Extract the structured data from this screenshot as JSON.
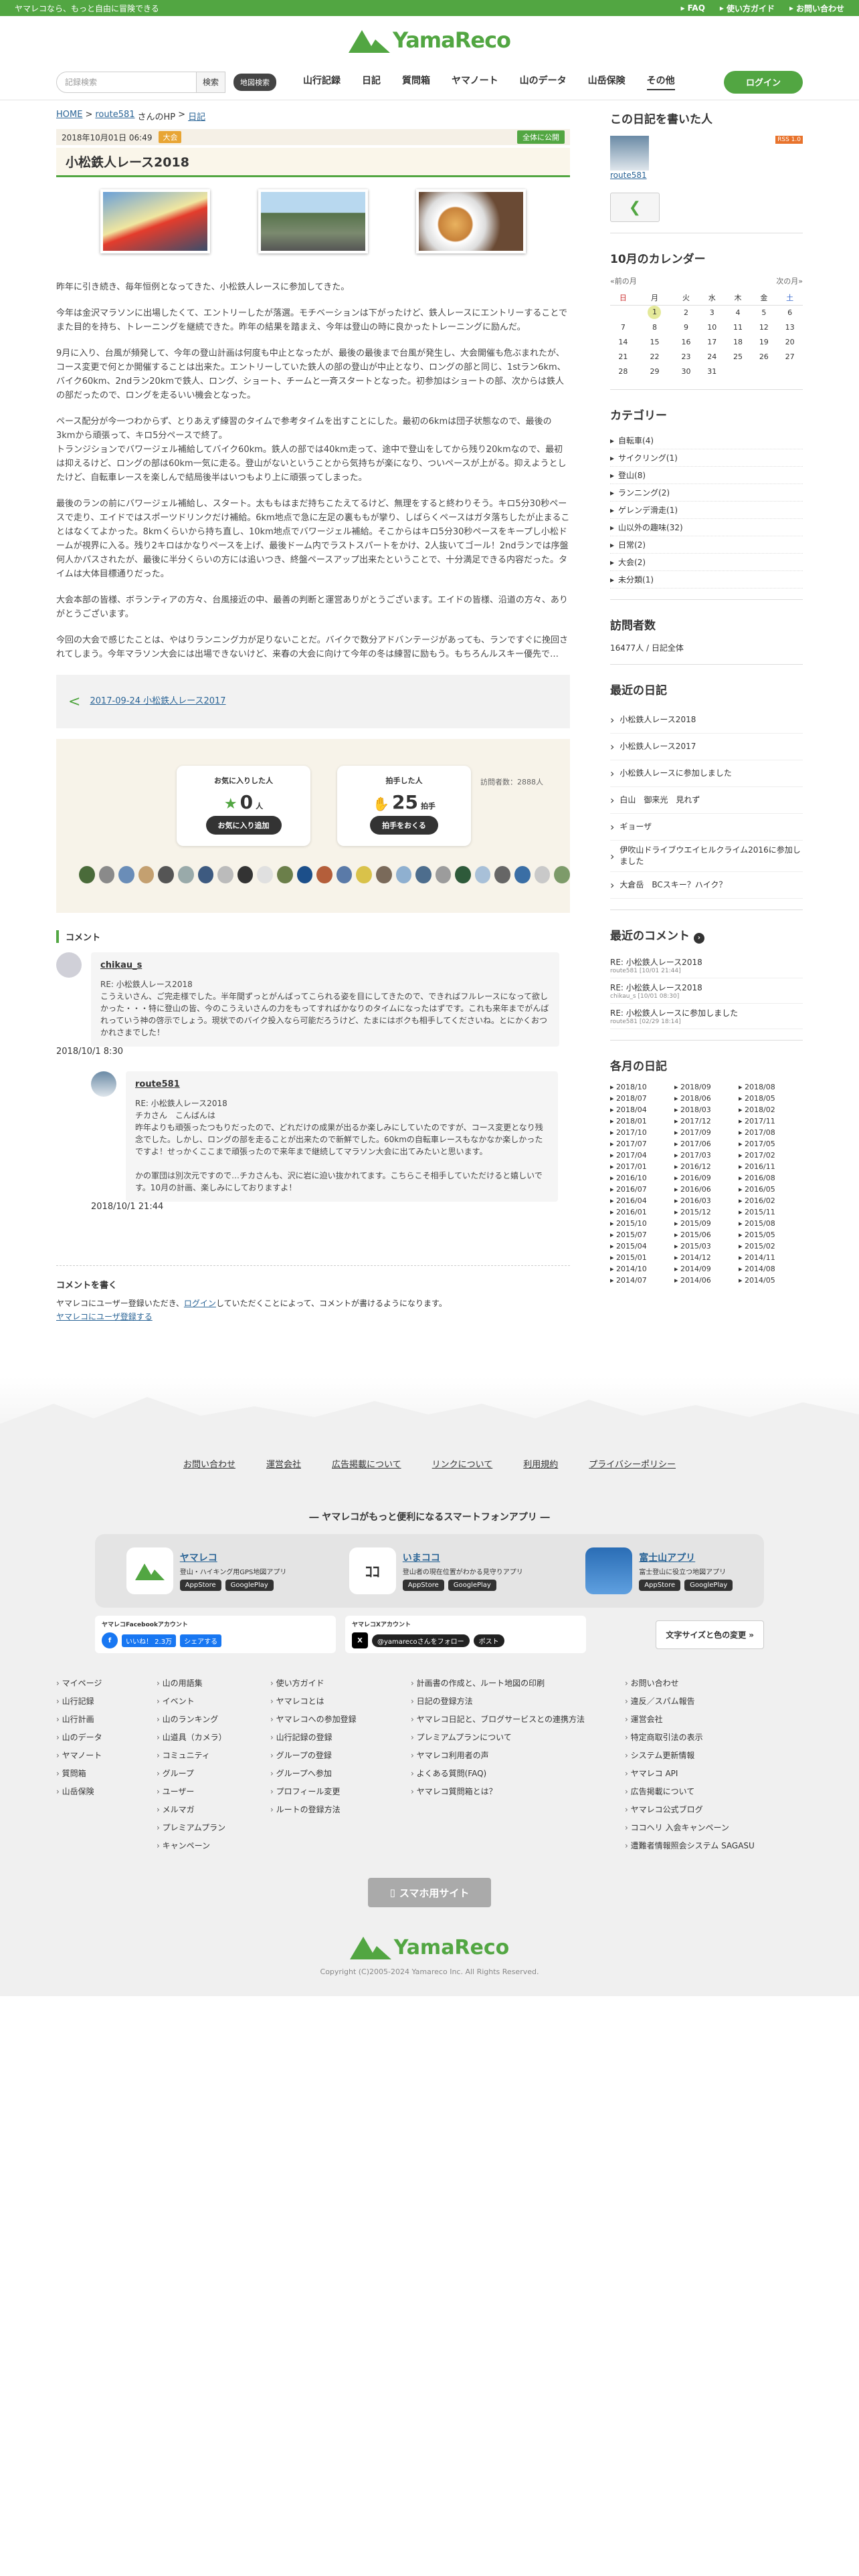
{
  "top": {
    "tagline": "ヤマレコなら、もっと自由に冒険できる",
    "faq": "FAQ",
    "guide": "使い方ガイド",
    "contact": "お問い合わせ"
  },
  "logo": "YamaReco",
  "search": {
    "placeholder": "記録検索",
    "btn": "検索",
    "map": "地図検索"
  },
  "nav": [
    "山行記録",
    "日記",
    "質問箱",
    "ヤマノート",
    "山のデータ",
    "山岳保険",
    "その他"
  ],
  "login": "ログイン",
  "breadcrumb": {
    "home": "HOME",
    "user": "route581",
    "suffix": "さんのHP",
    "sep": ">",
    "diary": "日記"
  },
  "meta": {
    "date": "2018年10月01日 06:49",
    "tag": "大会",
    "public": "全体に公開"
  },
  "title": "小松鉄人レース2018",
  "paragraphs": [
    "昨年に引き続き、毎年恒例となってきた、小松鉄人レースに参加してきた。",
    "今年は金沢マラソンに出場したくて、エントリーしたが落選。モチベーションは下がったけど、鉄人レースにエントリーすることで また目的を持ち、トレーニングを継続できた。昨年の結果を踏まえ、今年は登山の時に良かったトレーニングに励んだ。",
    "9月に入り、台風が頻発して、今年の登山計画は何度も中止となったが、最後の最後まで台風が発生し、大会開催も危ぶまれたが、コース変更で何とか開催することは出来た。エントリーしていた鉄人の部の登山が中止となり、ロングの部と同じ、1stラン6km、バイク60km、2ndラン20kmで鉄人、ロング、ショート、チームと一斉スタートとなった。初参加はショートの部、次からは鉄人の部だったので、ロングを走るいい機会となった。",
    "ペース配分が今一つわからず、とりあえず練習のタイムで参考タイムを出すことにした。最初の6kmは団子状態なので、最後の3kmから頑張って、キロ5分ペースで終了。\nトランジションでバワージェル補給してバイク60km。鉄人の部では40km走って、途中で登山をしてから残り20kmなので、最初は抑えるけど、ロングの部は60km一気に走る。登山がないということから気持ちが楽になり、ついペースが上がる。抑えようとしたけど、自転車レースを楽しんで結局後半はいつもより上に頑張ってしまった。",
    "最後のランの前にバワージェル補給し、スタート。太ももはまだ持ちこたえてるけど、無理をすると終わりそう。キロ5分30秒ペースで走り、エイドではスポーツドリンクだけ補給。6km地点で急に左足の裏ももが攣り、しばらくペースはガタ落ちしたが止まることはなくてよかった。8kmくらいから持ち直し、10km地点でバワージェル補給。そこからはキロ5分30秒ペースをキープし小松ドームが視界に入る。残り2キロはかなりペースを上げ、最後ドーム内でラストスパートをかけ、2人抜いてゴール！2ndランでは序盤何人かパスされたが、最後に半分くらいの方には追いつき、終盤ペースアップ出来たということで、十分満足できる内容だった。タイムは大体目標通りだった。",
    "大会本部の皆様、ボランティアの方々、台風接近の中、最善の判断と運営ありがとうございます。エイドの皆様、沿道の方々、ありがとうございます。",
    "今回の大会で感じたことは、やはりランニング力が足りないことだ。バイクで数分アドバンテージがあっても、ランですぐに挽回されてしまう。今年マラソン大会には出場できないけど、来春の大会に向けて今年の冬は練習に励もう。もちろんルスキー優先で…"
  ],
  "prev": {
    "label": "2017-09-24 小松鉄人レース2017",
    "arrow": "<"
  },
  "likes": {
    "fav_label": "お気に入りした人",
    "fav_count": "0",
    "fav_unit": "人",
    "fav_btn": "お気に入り追加",
    "clap_label": "拍手した人",
    "clap_count": "25",
    "clap_unit": "拍手",
    "clap_btn": "拍手をおくる",
    "views": "訪問者数：2888人"
  },
  "comment_h": "コメント",
  "comments": [
    {
      "name": "chikau_s",
      "text": "RE: 小松鉄人レース2018\nこうえいさん、ご完走様でした。半年間ずっとがんばってこられる姿を目にしてきたので、できればフルレースになって欲しかった・・・特に登山の皆、今のこうえいさんの力をもってすればかなりのタイムになったはずです。これも来年までがんばれっていう神の啓示でしょう。現状でのバイク投入なら可能だろうけど、たまにはボクも相手してくださいね。とにかくおつかれさまでした！",
      "date": "2018/10/1 8:30"
    },
    {
      "name": "route581",
      "text": "RE: 小松鉄人レース2018\nチカさん　こんばんは\n昨年よりも頑張ったつもりだったので、どれだけの成果が出るか楽しみにしていたのですが、コース変更となり残念でした。しかし、ロングの部を走ることが出来たので新鮮でした。60kmの自転車レースもなかなか楽しかったですよ！せっかくここまで頑張ったので来年まで継続してマラソン大会に出てみたいと思います。\n\nかの軍団は別次元ですので…チカさんも、沢に岩に迫い抜かれてます。こちらこそ相手していただけると嬉しいです。10月の計画、楽しみにしておりますよ！",
      "date": "2018/10/1 21:44"
    }
  ],
  "write": {
    "h": "コメントを書く",
    "t1": "ヤマレコにユーザー登録いただき、",
    "t2": "ログイン",
    "t3": "していただくことによって、コメントが書けるようになります。",
    "reg": "ヤマレコにユーザ登録する"
  },
  "side": {
    "author_h": "この日記を書いた人",
    "author": "route581",
    "rss": "RSS 1.0",
    "cal_h": "10月のカレンダー",
    "cal_prev": "«前の月",
    "cal_next": "次の月»",
    "days": [
      "日",
      "月",
      "火",
      "水",
      "木",
      "金",
      "土"
    ],
    "weeks": [
      [
        "",
        "1",
        "2",
        "3",
        "4",
        "5",
        "6"
      ],
      [
        "7",
        "8",
        "9",
        "10",
        "11",
        "12",
        "13"
      ],
      [
        "14",
        "15",
        "16",
        "17",
        "18",
        "19",
        "20"
      ],
      [
        "21",
        "22",
        "23",
        "24",
        "25",
        "26",
        "27"
      ],
      [
        "28",
        "29",
        "30",
        "31",
        "",
        "",
        ""
      ]
    ],
    "cat_h": "カテゴリー",
    "cats": [
      "自転車(4)",
      "サイクリング(1)",
      "登山(8)",
      "ランニング(2)",
      "ゲレンデ滑走(1)",
      "山以外の趣味(32)",
      "日常(2)",
      "大会(2)",
      "未分類(1)"
    ],
    "visit_h": "訪問者数",
    "visit": "16477人 / 日記全体",
    "recent_h": "最近の日記",
    "recent": [
      "小松鉄人レース2018",
      "小松鉄人レース2017",
      "小松鉄人レースに参加しました",
      "白山　御来光　見れず",
      "ギョーザ",
      "伊吹山ドライブウエイヒルクライム2016に参加しました",
      "大倉岳　BCスキー？ハイク？"
    ],
    "rc_h": "最近のコメント",
    "rc": [
      {
        "t": "RE: 小松鉄人レース2018",
        "s": "route581 [10/01 21:44]"
      },
      {
        "t": "RE: 小松鉄人レース2018",
        "s": "chikau_s [10/01 08:30]"
      },
      {
        "t": "RE: 小松鉄人レースに参加しました",
        "s": "route581 [02/29 18:14]"
      }
    ],
    "months_h": "各月の日記",
    "months": [
      "2018/10",
      "2018/09",
      "2018/08",
      "2018/07",
      "2018/06",
      "2018/05",
      "2018/04",
      "2018/03",
      "2018/02",
      "2018/01",
      "2017/12",
      "2017/11",
      "2017/10",
      "2017/09",
      "2017/08",
      "2017/07",
      "2017/06",
      "2017/05",
      "2017/04",
      "2017/03",
      "2017/02",
      "2017/01",
      "2016/12",
      "2016/11",
      "2016/10",
      "2016/09",
      "2016/08",
      "2016/07",
      "2016/06",
      "2016/05",
      "2016/04",
      "2016/03",
      "2016/02",
      "2016/01",
      "2015/12",
      "2015/11",
      "2015/10",
      "2015/09",
      "2015/08",
      "2015/07",
      "2015/06",
      "2015/05",
      "2015/04",
      "2015/03",
      "2015/02",
      "2015/01",
      "2014/12",
      "2014/11",
      "2014/10",
      "2014/09",
      "2014/08",
      "2014/07",
      "2014/06",
      "2014/05"
    ]
  },
  "footer": {
    "links": [
      "お問い合わせ",
      "運営会社",
      "広告掲載について",
      "リンクについて",
      "利用規約",
      "プライバシーポリシー"
    ],
    "apps_h": "― ヤマレコがもっと便利になるスマートフォンアプリ ―",
    "apps": [
      {
        "n": "ヤマレコ",
        "d": "登山・ハイキング用GPS地図アプリ"
      },
      {
        "n": "いまココ",
        "d": "登山者の現在位置がわかる見守りアプリ"
      },
      {
        "n": "富士山アプリ",
        "d": "富士登山に役立つ地図アプリ"
      }
    ],
    "appstore": "AppStore",
    "gplay": "GooglePlay",
    "fb_h": "ヤマレコFacebookアカウント",
    "fb_like": "いいね！ 2.3万",
    "fb_share": "シェアする",
    "x_h": "ヤマレコXアカウント",
    "x_follow": "@yamarecoさんをフォロー",
    "x_post": "ポスト",
    "fsize": "文字サイズと色の変更 »",
    "col1": [
      "マイページ",
      "山行記録",
      "山行計画",
      "山のデータ",
      "ヤマノート",
      "質問箱",
      "山岳保険"
    ],
    "col2": [
      "山の用語集",
      "イベント",
      "山のランキング",
      "山道具（カメラ）",
      "コミュニティ",
      "グループ",
      "ユーザー",
      "メルマガ",
      "プレミアムプラン",
      "キャンペーン"
    ],
    "col3h": "使い方ガイド",
    "col3": [
      "ヤマレコとは",
      "ヤマレコへの参加登録",
      "山行記録の登録",
      "グループの登録",
      "グループへ参加",
      "プロフィール変更",
      "ルートの登録方法"
    ],
    "col4": [
      "計画書の作成と、ルート地図の印刷",
      "日記の登録方法",
      "ヤマレコ日記と、ブログサービスとの連携方法",
      "プレミアムプランについて",
      "ヤマレコ利用者の声",
      "よくある質問(FAQ)",
      "ヤマレコ質問箱とは？"
    ],
    "col5": [
      "お問い合わせ",
      "違反／スパム報告",
      "運営会社",
      "特定商取引法の表示",
      "システム更新情報",
      "ヤマレコ API",
      "広告掲載について",
      "ヤマレコ公式ブログ",
      "ココヘリ 入会キャンペーン",
      "遭難者情報照会システム SAGASU"
    ],
    "sp": "スマホ用サイト",
    "copy": "Copyright (C)2005-2024 Yamareco Inc. All Rights Reserved."
  },
  "colors": {
    "brand": "#52a642"
  }
}
